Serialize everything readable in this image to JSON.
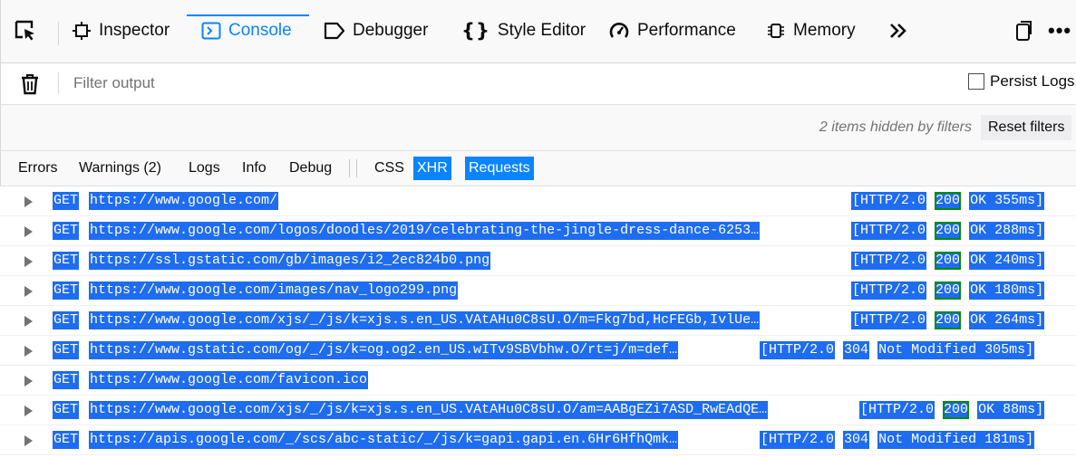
{
  "toolbar": {
    "picker_icon": "element-picker-icon",
    "tabs": [
      {
        "label": "Inspector",
        "icon": "inspector-icon"
      },
      {
        "label": "Console",
        "icon": "console-icon",
        "selected": true
      },
      {
        "label": "Debugger",
        "icon": "debugger-icon"
      },
      {
        "label": "Style Editor",
        "icon": "style-editor-icon"
      },
      {
        "label": "Performance",
        "icon": "performance-icon"
      },
      {
        "label": "Memory",
        "icon": "memory-icon"
      }
    ],
    "overflow_icon": "chevron-double-right-icon",
    "dock_icon": "dock-icon",
    "more_icon": "ellipsis-icon",
    "accent_color": "#0a84ff"
  },
  "filter": {
    "placeholder": "Filter output",
    "trash_icon": "trash-icon",
    "persist_label": "Persist Logs",
    "persist_checked": false
  },
  "hidden": {
    "text": "2 items hidden by filters",
    "reset_label": "Reset filters"
  },
  "categories": [
    {
      "label": "Errors",
      "active": false
    },
    {
      "label": "Warnings (2)",
      "active": false
    },
    {
      "label": "Logs",
      "active": false
    },
    {
      "label": "Info",
      "active": false
    },
    {
      "label": "Debug",
      "active": false
    },
    {
      "label": "CSS",
      "active": false
    },
    {
      "label": "XHR",
      "active": true
    },
    {
      "label": "Requests",
      "active": true
    }
  ],
  "messages": [
    {
      "method": "GET",
      "url": "https://www.google.com/",
      "protocol": "[HTTP/2.0",
      "code": "200",
      "status": "OK 355ms]"
    },
    {
      "method": "GET",
      "url": "https://www.google.com/logos/doodles/2019/celebrating-the-jingle-dress-dance-6253…",
      "protocol": "[HTTP/2.0",
      "code": "200",
      "status": "OK 288ms]"
    },
    {
      "method": "GET",
      "url": "https://ssl.gstatic.com/gb/images/i2_2ec824b0.png",
      "protocol": "[HTTP/2.0",
      "code": "200",
      "status": "OK 240ms]"
    },
    {
      "method": "GET",
      "url": "https://www.google.com/images/nav_logo299.png",
      "protocol": "[HTTP/2.0",
      "code": "200",
      "status": "OK 180ms]"
    },
    {
      "method": "GET",
      "url": "https://www.google.com/xjs/_/js/k=xjs.s.en_US.VAtAHu0C8sU.O/m=Fkg7bd,HcFEGb,IvlUe…",
      "protocol": "[HTTP/2.0",
      "code": "200",
      "status": "OK 264ms]"
    },
    {
      "method": "GET",
      "url": "https://www.gstatic.com/og/_/js/k=og.og2.en_US.wITv9SBVbhw.O/rt=j/m=def…",
      "protocol": "[HTTP/2.0",
      "code": "304",
      "status": "Not Modified 305ms]"
    },
    {
      "method": "GET",
      "url": "https://www.google.com/favicon.ico",
      "protocol": "",
      "code": "",
      "status": ""
    },
    {
      "method": "GET",
      "url": "https://www.google.com/xjs/_/js/k=xjs.s.en_US.VAtAHu0C8sU.O/am=AABgEZi7ASD_RwEAdQE…",
      "protocol": "[HTTP/2.0",
      "code": "200",
      "status": "OK 88ms]"
    },
    {
      "method": "GET",
      "url": "https://apis.google.com/_/scs/abc-static/_/js/k=gapi.gapi.en.6Hr6HfhQmk…",
      "protocol": "[HTTP/2.0",
      "code": "304",
      "status": "Not Modified 181ms]"
    }
  ]
}
